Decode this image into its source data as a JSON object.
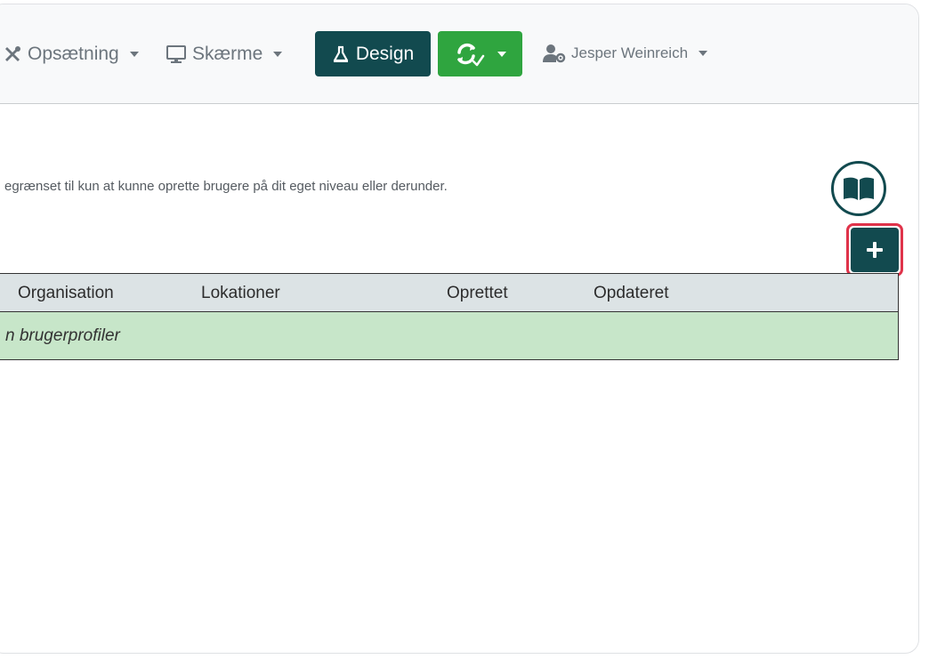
{
  "navbar": {
    "setup_label": "Opsætning",
    "screens_label": "Skærme",
    "design_label": "Design",
    "user_name": "Jesper Weinreich"
  },
  "main": {
    "info_text": "egrænset til kun at kunne oprette brugere på dit eget niveau eller derunder.",
    "table": {
      "columns": [
        "Organisation",
        "Lokationer",
        "Oprettet",
        "Opdateret"
      ],
      "empty_text": "n brugerprofiler"
    }
  },
  "colors": {
    "primary": "#124a4f",
    "success": "#2fa53f",
    "highlight": "#e0334a",
    "empty_row": "#c7e6c9",
    "table_header": "#dce3e5"
  },
  "icons": {
    "setup": "tools-icon",
    "screens": "monitor-icon",
    "design": "flask-icon",
    "sync": "sync-check-icon",
    "user": "user-gear-icon",
    "manual": "book-icon",
    "add": "plus-icon"
  }
}
